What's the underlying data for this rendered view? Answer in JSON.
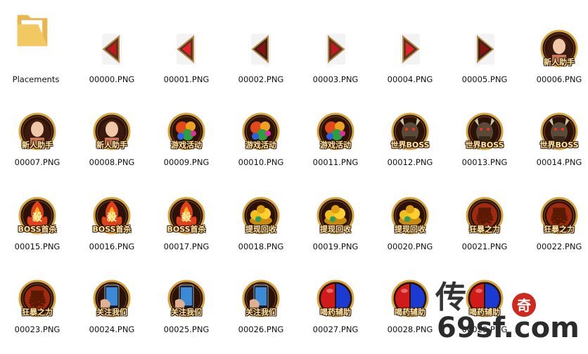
{
  "folder": {
    "name": "Placements"
  },
  "files": [
    {
      "name": "00000.PNG",
      "kind": "arrow-left",
      "label": ""
    },
    {
      "name": "00001.PNG",
      "kind": "arrow-left-bright",
      "label": ""
    },
    {
      "name": "00002.PNG",
      "kind": "arrow-left-dark",
      "label": ""
    },
    {
      "name": "00003.PNG",
      "kind": "arrow-right",
      "label": ""
    },
    {
      "name": "00004.PNG",
      "kind": "arrow-right-bright",
      "label": ""
    },
    {
      "name": "00005.PNG",
      "kind": "arrow-right-dark",
      "label": ""
    },
    {
      "name": "00006.PNG",
      "kind": "helper-girl",
      "label": "新人助手"
    },
    {
      "name": "00007.PNG",
      "kind": "helper-girl",
      "label": "新人助手"
    },
    {
      "name": "00008.PNG",
      "kind": "helper-girl",
      "label": "新人助手"
    },
    {
      "name": "00009.PNG",
      "kind": "events",
      "label": "游戏活动"
    },
    {
      "name": "00010.PNG",
      "kind": "events",
      "label": "游戏活动"
    },
    {
      "name": "00011.PNG",
      "kind": "events",
      "label": "游戏活动"
    },
    {
      "name": "00012.PNG",
      "kind": "world-boss",
      "label": "世界BOSS"
    },
    {
      "name": "00013.PNG",
      "kind": "world-boss",
      "label": "世界BOSS"
    },
    {
      "name": "00014.PNG",
      "kind": "world-boss",
      "label": "世界BOSS"
    },
    {
      "name": "00015.PNG",
      "kind": "boss-firstkill",
      "label": "BOSS首杀"
    },
    {
      "name": "00016.PNG",
      "kind": "boss-firstkill",
      "label": "BOSS首杀"
    },
    {
      "name": "00017.PNG",
      "kind": "boss-firstkill",
      "label": "BOSS首杀"
    },
    {
      "name": "00018.PNG",
      "kind": "withdraw",
      "label": "提现回收"
    },
    {
      "name": "00019.PNG",
      "kind": "withdraw",
      "label": "提现回收"
    },
    {
      "name": "00020.PNG",
      "kind": "withdraw",
      "label": "提现回收"
    },
    {
      "name": "00021.PNG",
      "kind": "rage",
      "label": "狂暴之力"
    },
    {
      "name": "00022.PNG",
      "kind": "rage",
      "label": "狂暴之力"
    },
    {
      "name": "00023.PNG",
      "kind": "rage",
      "label": "狂暴之力"
    },
    {
      "name": "00024.PNG",
      "kind": "follow",
      "label": "关注我们"
    },
    {
      "name": "00025.PNG",
      "kind": "follow",
      "label": "关注我们"
    },
    {
      "name": "00026.PNG",
      "kind": "follow",
      "label": "关注我们"
    },
    {
      "name": "00027.PNG",
      "kind": "potion",
      "label": "喝药辅助"
    },
    {
      "name": "00028.PNG",
      "kind": "potion",
      "label": "喝药辅助"
    },
    {
      "name": "00029.PNG",
      "kind": "potion",
      "label": "喝药辅助"
    }
  ],
  "watermark": {
    "logo_chars": "传奇",
    "site": "69sf.com"
  },
  "colors": {
    "folder": "#f2c862",
    "arrow_red": "#c4161c",
    "ring_gold": "#d8a640",
    "potion_red": "#d11a1a",
    "potion_blue": "#1a3ad1"
  }
}
